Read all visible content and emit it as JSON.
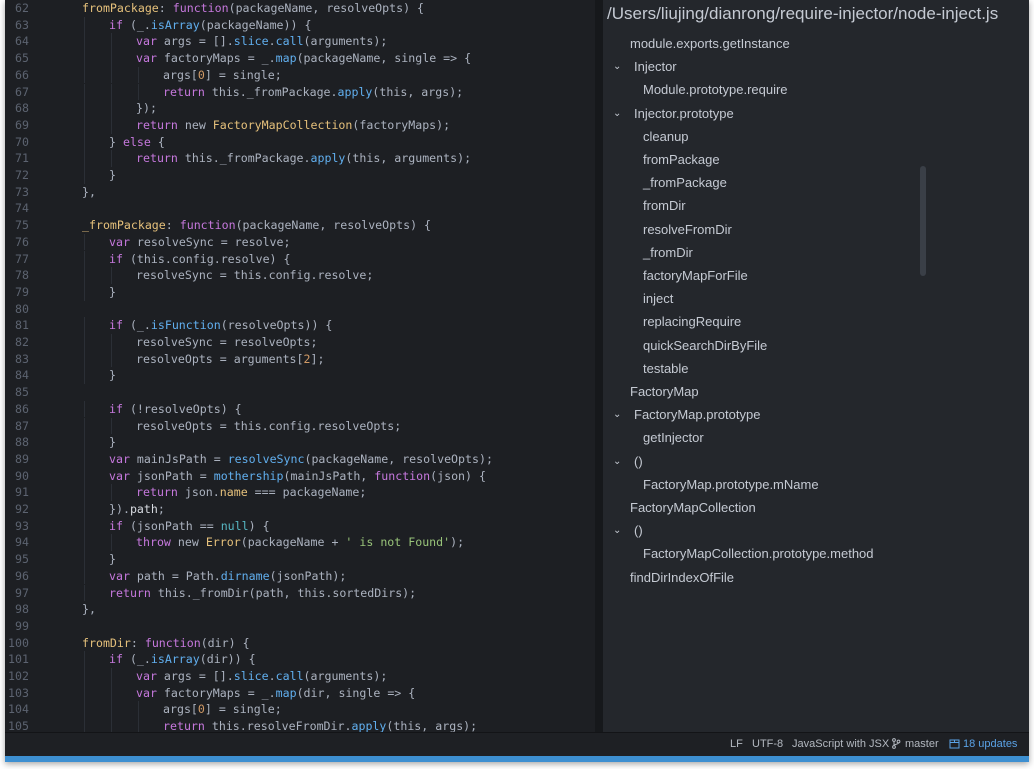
{
  "editor": {
    "lines": [
      {
        "n": "62",
        "indent": 1,
        "tokens": [
          [
            "prop",
            "fromPackage"
          ],
          [
            "punc",
            ": "
          ],
          [
            "kw",
            "function"
          ],
          [
            "punc",
            "(packageName, resolveOpts) {"
          ]
        ]
      },
      {
        "n": "63",
        "indent": 2,
        "tokens": [
          [
            "kw",
            "if"
          ],
          [
            "punc",
            " (_."
          ],
          [
            "fn",
            "isArray"
          ],
          [
            "punc",
            "(packageName)) {"
          ]
        ]
      },
      {
        "n": "64",
        "indent": 3,
        "tokens": [
          [
            "kw",
            "var"
          ],
          [
            "punc",
            " args = []."
          ],
          [
            "fn",
            "slice"
          ],
          [
            "punc",
            "."
          ],
          [
            "fn",
            "call"
          ],
          [
            "punc",
            "(arguments);"
          ]
        ]
      },
      {
        "n": "65",
        "indent": 3,
        "tokens": [
          [
            "kw",
            "var"
          ],
          [
            "punc",
            " factoryMaps = _."
          ],
          [
            "fn",
            "map"
          ],
          [
            "punc",
            "(packageName, single => {"
          ]
        ]
      },
      {
        "n": "66",
        "indent": 4,
        "tokens": [
          [
            "punc",
            "args["
          ],
          [
            "num",
            "0"
          ],
          [
            "punc",
            "] = single;"
          ]
        ]
      },
      {
        "n": "67",
        "indent": 4,
        "tokens": [
          [
            "kw",
            "return"
          ],
          [
            "punc",
            " this._fromPackage."
          ],
          [
            "fn",
            "apply"
          ],
          [
            "punc",
            "(this, args);"
          ]
        ]
      },
      {
        "n": "68",
        "indent": 3,
        "tokens": [
          [
            "punc",
            "});"
          ]
        ]
      },
      {
        "n": "69",
        "indent": 3,
        "tokens": [
          [
            "kw",
            "return"
          ],
          [
            "punc",
            " new "
          ],
          [
            "cls",
            "FactoryMapCollection"
          ],
          [
            "punc",
            "(factoryMaps);"
          ]
        ]
      },
      {
        "n": "70",
        "indent": 2,
        "tokens": [
          [
            "punc",
            "} "
          ],
          [
            "kw",
            "else"
          ],
          [
            "punc",
            " {"
          ]
        ]
      },
      {
        "n": "71",
        "indent": 3,
        "tokens": [
          [
            "kw",
            "return"
          ],
          [
            "punc",
            " this._fromPackage."
          ],
          [
            "fn",
            "apply"
          ],
          [
            "punc",
            "(this, arguments);"
          ]
        ]
      },
      {
        "n": "72",
        "indent": 2,
        "tokens": [
          [
            "punc",
            "}"
          ]
        ]
      },
      {
        "n": "73",
        "indent": 1,
        "tokens": [
          [
            "punc",
            "},"
          ]
        ]
      },
      {
        "n": "74",
        "indent": 0,
        "tokens": []
      },
      {
        "n": "75",
        "indent": 1,
        "tokens": [
          [
            "prop",
            "_fromPackage"
          ],
          [
            "punc",
            ": "
          ],
          [
            "kw",
            "function"
          ],
          [
            "punc",
            "(packageName, resolveOpts) {"
          ]
        ]
      },
      {
        "n": "76",
        "indent": 2,
        "tokens": [
          [
            "kw",
            "var"
          ],
          [
            "punc",
            " resolveSync = resolve;"
          ]
        ]
      },
      {
        "n": "77",
        "indent": 2,
        "tokens": [
          [
            "kw",
            "if"
          ],
          [
            "punc",
            " (this.config.resolve) {"
          ]
        ]
      },
      {
        "n": "78",
        "indent": 3,
        "tokens": [
          [
            "punc",
            "resolveSync = this.config.resolve;"
          ]
        ]
      },
      {
        "n": "79",
        "indent": 2,
        "tokens": [
          [
            "punc",
            "}"
          ]
        ]
      },
      {
        "n": "80",
        "indent": 0,
        "tokens": []
      },
      {
        "n": "81",
        "indent": 2,
        "tokens": [
          [
            "kw",
            "if"
          ],
          [
            "punc",
            " (_."
          ],
          [
            "fn",
            "isFunction"
          ],
          [
            "punc",
            "(resolveOpts)) {"
          ]
        ]
      },
      {
        "n": "82",
        "indent": 3,
        "tokens": [
          [
            "punc",
            "resolveSync = resolveOpts;"
          ]
        ]
      },
      {
        "n": "83",
        "indent": 3,
        "tokens": [
          [
            "punc",
            "resolveOpts = arguments["
          ],
          [
            "num",
            "2"
          ],
          [
            "punc",
            "];"
          ]
        ]
      },
      {
        "n": "84",
        "indent": 2,
        "tokens": [
          [
            "punc",
            "}"
          ]
        ]
      },
      {
        "n": "85",
        "indent": 0,
        "tokens": []
      },
      {
        "n": "86",
        "indent": 2,
        "tokens": [
          [
            "kw",
            "if"
          ],
          [
            "punc",
            " (!resolveOpts) {"
          ]
        ]
      },
      {
        "n": "87",
        "indent": 3,
        "tokens": [
          [
            "punc",
            "resolveOpts = this.config.resolveOpts;"
          ]
        ]
      },
      {
        "n": "88",
        "indent": 2,
        "tokens": [
          [
            "punc",
            "}"
          ]
        ]
      },
      {
        "n": "89",
        "indent": 2,
        "tokens": [
          [
            "kw",
            "var"
          ],
          [
            "punc",
            " mainJsPath = "
          ],
          [
            "fn",
            "resolveSync"
          ],
          [
            "punc",
            "(packageName, resolveOpts);"
          ]
        ]
      },
      {
        "n": "90",
        "indent": 2,
        "tokens": [
          [
            "kw",
            "var"
          ],
          [
            "punc",
            " jsonPath = "
          ],
          [
            "fn",
            "mothership"
          ],
          [
            "punc",
            "(mainJsPath, "
          ],
          [
            "kw",
            "function"
          ],
          [
            "punc",
            "(json) {"
          ]
        ]
      },
      {
        "n": "91",
        "indent": 3,
        "tokens": [
          [
            "kw",
            "return"
          ],
          [
            "punc",
            " json."
          ],
          [
            "prop",
            "name"
          ],
          [
            "punc",
            " === packageName;"
          ]
        ]
      },
      {
        "n": "92",
        "indent": 2,
        "tokens": [
          [
            "punc",
            "})."
          ],
          [
            "plain",
            "path"
          ],
          [
            "punc",
            ";"
          ]
        ]
      },
      {
        "n": "93",
        "indent": 2,
        "tokens": [
          [
            "kw",
            "if"
          ],
          [
            "punc",
            " (jsonPath == "
          ],
          [
            "lit",
            "null"
          ],
          [
            "punc",
            ") {"
          ]
        ]
      },
      {
        "n": "94",
        "indent": 3,
        "tokens": [
          [
            "kw",
            "throw"
          ],
          [
            "punc",
            " new "
          ],
          [
            "cls",
            "Error"
          ],
          [
            "punc",
            "(packageName + "
          ],
          [
            "str",
            "' is not Found'"
          ],
          [
            "punc",
            ");"
          ]
        ]
      },
      {
        "n": "95",
        "indent": 2,
        "tokens": [
          [
            "punc",
            "}"
          ]
        ]
      },
      {
        "n": "96",
        "indent": 2,
        "tokens": [
          [
            "kw",
            "var"
          ],
          [
            "punc",
            " path = Path."
          ],
          [
            "fn",
            "dirname"
          ],
          [
            "punc",
            "(jsonPath);"
          ]
        ]
      },
      {
        "n": "97",
        "indent": 2,
        "tokens": [
          [
            "kw",
            "return"
          ],
          [
            "punc",
            " this._fromDir(path, this.sortedDirs);"
          ]
        ]
      },
      {
        "n": "98",
        "indent": 1,
        "tokens": [
          [
            "punc",
            "},"
          ]
        ]
      },
      {
        "n": "99",
        "indent": 0,
        "tokens": []
      },
      {
        "n": "100",
        "indent": 1,
        "tokens": [
          [
            "prop",
            "fromDir"
          ],
          [
            "punc",
            ": "
          ],
          [
            "kw",
            "function"
          ],
          [
            "punc",
            "(dir) {"
          ]
        ]
      },
      {
        "n": "101",
        "indent": 2,
        "tokens": [
          [
            "kw",
            "if"
          ],
          [
            "punc",
            " (_."
          ],
          [
            "fn",
            "isArray"
          ],
          [
            "punc",
            "(dir)) {"
          ]
        ]
      },
      {
        "n": "102",
        "indent": 3,
        "tokens": [
          [
            "kw",
            "var"
          ],
          [
            "punc",
            " args = []."
          ],
          [
            "fn",
            "slice"
          ],
          [
            "punc",
            "."
          ],
          [
            "fn",
            "call"
          ],
          [
            "punc",
            "(arguments);"
          ]
        ]
      },
      {
        "n": "103",
        "indent": 3,
        "tokens": [
          [
            "kw",
            "var"
          ],
          [
            "punc",
            " factoryMaps = _."
          ],
          [
            "fn",
            "map"
          ],
          [
            "punc",
            "(dir, single => {"
          ]
        ]
      },
      {
        "n": "104",
        "indent": 4,
        "tokens": [
          [
            "punc",
            "args["
          ],
          [
            "num",
            "0"
          ],
          [
            "punc",
            "] = single;"
          ]
        ]
      },
      {
        "n": "105",
        "indent": 4,
        "tokens": [
          [
            "kw",
            "return"
          ],
          [
            "punc",
            " this.resolveFromDir."
          ],
          [
            "fn",
            "apply"
          ],
          [
            "punc",
            "(this, args);"
          ]
        ]
      }
    ]
  },
  "symbols": {
    "title": "/Users/liujing/dianrong/require-injector/node-inject.js",
    "items": [
      {
        "label": "module.exports.getInstance",
        "level": 0,
        "chevron": false
      },
      {
        "label": "Injector",
        "level": 0,
        "chevron": true
      },
      {
        "label": "Module.prototype.require",
        "level": 1,
        "chevron": false
      },
      {
        "label": "Injector.prototype",
        "level": 0,
        "chevron": true
      },
      {
        "label": "cleanup",
        "level": 1,
        "chevron": false
      },
      {
        "label": "fromPackage",
        "level": 1,
        "chevron": false
      },
      {
        "label": "_fromPackage",
        "level": 1,
        "chevron": false
      },
      {
        "label": "fromDir",
        "level": 1,
        "chevron": false
      },
      {
        "label": "resolveFromDir",
        "level": 1,
        "chevron": false
      },
      {
        "label": "_fromDir",
        "level": 1,
        "chevron": false
      },
      {
        "label": "factoryMapForFile",
        "level": 1,
        "chevron": false
      },
      {
        "label": "inject",
        "level": 1,
        "chevron": false
      },
      {
        "label": "replacingRequire",
        "level": 1,
        "chevron": false
      },
      {
        "label": "quickSearchDirByFile",
        "level": 1,
        "chevron": false
      },
      {
        "label": "testable",
        "level": 1,
        "chevron": false
      },
      {
        "label": "FactoryMap",
        "level": 0,
        "chevron": false
      },
      {
        "label": "FactoryMap.prototype",
        "level": 0,
        "chevron": true
      },
      {
        "label": "getInjector",
        "level": 1,
        "chevron": false
      },
      {
        "label": "()",
        "level": 0,
        "chevron": true
      },
      {
        "label": "FactoryMap.prototype.mName",
        "level": 1,
        "chevron": false
      },
      {
        "label": "FactoryMapCollection",
        "level": 0,
        "chevron": false
      },
      {
        "label": "()",
        "level": 0,
        "chevron": true
      },
      {
        "label": "FactoryMapCollection.prototype.method",
        "level": 1,
        "chevron": false
      },
      {
        "label": "findDirIndexOfFile",
        "level": 0,
        "chevron": false
      }
    ]
  },
  "statusbar": {
    "line_ending": "LF",
    "encoding": "UTF-8",
    "grammar": "JavaScript with JSX",
    "branch": "master",
    "updates": "18 updates",
    "branch_icon": "git-branch-icon",
    "updates_icon": "package-icon"
  },
  "colors": {
    "editor_bg": "#1d1f23",
    "sidebar_bg": "#24272c",
    "accent": "#3d8fd1",
    "keyword": "#c678dd",
    "function": "#61afef",
    "property": "#e5c07b",
    "string": "#98c379",
    "number": "#d19a66"
  }
}
